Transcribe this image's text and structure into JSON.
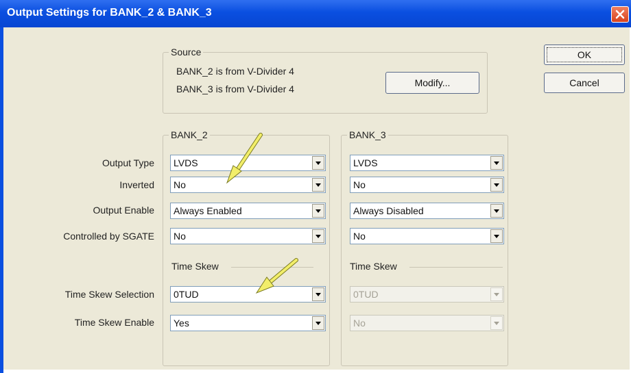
{
  "window": {
    "title": "Output Settings for BANK_2 & BANK_3"
  },
  "source": {
    "group_label": "Source",
    "line1": "BANK_2 is from V-Divider 4",
    "line2": "BANK_3 is from V-Divider 4",
    "modify_label": "Modify..."
  },
  "buttons": {
    "ok": "OK",
    "cancel": "Cancel"
  },
  "row_labels": {
    "output_type": "Output Type",
    "inverted": "Inverted",
    "output_enable": "Output Enable",
    "controlled_by_sgate": "Controlled by SGATE",
    "time_skew_selection": "Time Skew Selection",
    "time_skew_enable": "Time Skew Enable"
  },
  "bank2": {
    "label": "BANK_2",
    "output_type": "LVDS",
    "inverted": "No",
    "output_enable": "Always Enabled",
    "controlled_by_sgate": "No",
    "time_skew_label": "Time Skew",
    "time_skew_selection": "0TUD",
    "time_skew_enable": "Yes"
  },
  "bank3": {
    "label": "BANK_3",
    "output_type": "LVDS",
    "inverted": "No",
    "output_enable": "Always Disabled",
    "controlled_by_sgate": "No",
    "time_skew_label": "Time Skew",
    "time_skew_selection": "0TUD",
    "time_skew_enable": "No"
  },
  "colors": {
    "titlebar": "#0a4fe0",
    "dialog_bg": "#ece9d8",
    "annotation_arrow": "#f2ee6a"
  }
}
